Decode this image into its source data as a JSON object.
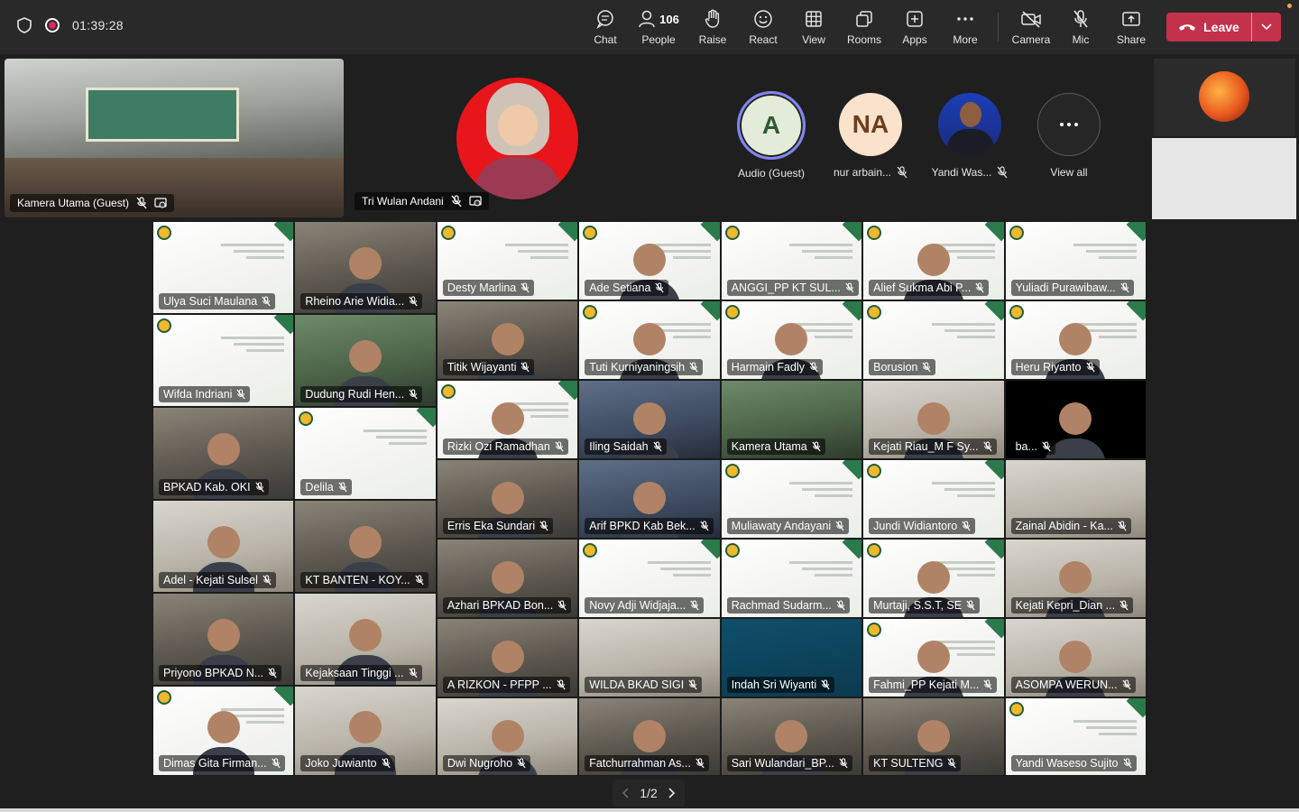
{
  "meeting": {
    "timer": "01:39:28"
  },
  "toolbar": {
    "chat": "Chat",
    "people": "People",
    "people_count": "106",
    "raise": "Raise",
    "react": "React",
    "view": "View",
    "rooms": "Rooms",
    "apps": "Apps",
    "more": "More",
    "camera": "Camera",
    "mic": "Mic",
    "share": "Share",
    "leave": "Leave"
  },
  "strip": {
    "kamera_utama": "Kamera Utama (Guest)",
    "tri_wulan": "Tri Wulan Andani",
    "audio_guest_initial": "A",
    "audio_guest_name": "Audio (Guest)",
    "nur_initial": "NA",
    "nur_name": "nur arbain...",
    "yandi_name": "Yandi Was...",
    "view_all": "View all"
  },
  "participants": [
    "Ulya Suci Maulana",
    "Rheino Arie Widia...",
    "Desty Marlina",
    "Ade Setiana",
    "ANGGI_PP KT SUL...",
    "Alief Sukma Abi P...",
    "Yuliadi Purawibaw...",
    "Wifda Indriani",
    "Dudung Rudi Hen...",
    "Titik Wijayanti",
    "Tuti Kurniyaningsih",
    "Harmain Fadly",
    "Borusion",
    "Heru Riyanto",
    "BPKAD Kab. OKI",
    "Delila",
    "Rizki Ozi Ramadhan",
    "Iling Saidah",
    "Kamera Utama",
    "Kejati Riau_M F Sy...",
    "ba...",
    "Adel - Kejati Sulsel",
    "KT BANTEN - KOY...",
    "Erris Eka Sundari",
    "Arif BPKD Kab Bek...",
    "Muliawaty Andayani",
    "Jundi Widiantoro",
    "Zainal Abidin - Ka...",
    "Priyono BPKAD N...",
    "Kejaksaan Tinggi ...",
    "Azhari BPKAD Bon...",
    "Novy Adji Widjaja...",
    "Rachmad Sudarm...",
    "Murtaji, S.S.T, SE",
    "Kejati Kepri_Dian ...",
    "Dimas Gita Firman...",
    "Joko Juwianto",
    "A RIZKON - PFPP ...",
    "WILDA BKAD SIGI",
    "Indah Sri Wiyanti",
    "Fahmi_PP Kejati M...",
    "ASOMPA WERUN...",
    "Dwi Nugroho",
    "Fatchurrahman As...",
    "Sari Wulandari_BP...",
    "KT SULTENG",
    "Yandi Waseso Sujito"
  ],
  "pager": {
    "label": "1/2"
  },
  "colors": {
    "leave": "#c4314b",
    "accent": "#7f85f5",
    "background": "#1f1f1f"
  }
}
